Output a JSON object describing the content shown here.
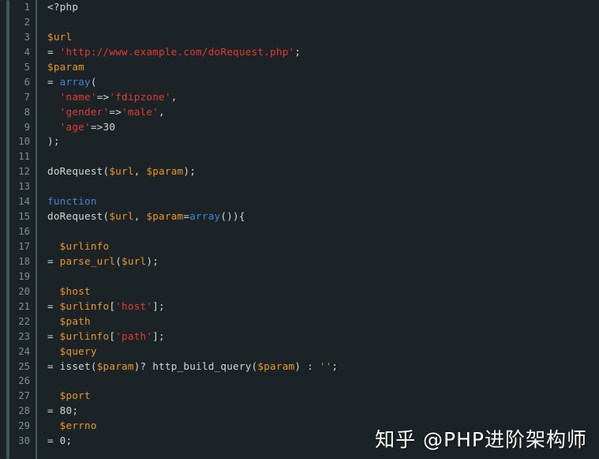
{
  "editor": {
    "language": "php",
    "background_color": "#1c2326",
    "line_number_color": "#7e8f93",
    "total_lines": 30,
    "first_visible_line": 1,
    "last_visible_line": 30
  },
  "palette": {
    "plain": "#d4d7d6",
    "variable": "#e8962e",
    "string": "#e03b35",
    "keyword": "#3d87d8",
    "function": "#e8962e",
    "number": "#d4d7d6",
    "gutter_rule": "#44565b",
    "scroll_rail": "#44565b"
  },
  "watermark": {
    "text": "知乎 @PHP进阶架构师",
    "color": "#ffffff"
  },
  "lines": [
    {
      "n": "1",
      "tokens": [
        {
          "t": "<?php",
          "c": "plain"
        }
      ]
    },
    {
      "n": "2",
      "tokens": []
    },
    {
      "n": "3",
      "tokens": [
        {
          "t": "$url",
          "c": "var"
        }
      ]
    },
    {
      "n": "4",
      "tokens": [
        {
          "t": "= ",
          "c": "plain"
        },
        {
          "t": "'http://www.example.com/doRequest.php'",
          "c": "string"
        },
        {
          "t": ";",
          "c": "punct"
        }
      ]
    },
    {
      "n": "5",
      "tokens": [
        {
          "t": "$param",
          "c": "var"
        }
      ]
    },
    {
      "n": "6",
      "tokens": [
        {
          "t": "= ",
          "c": "plain"
        },
        {
          "t": "array",
          "c": "keyword"
        },
        {
          "t": "(",
          "c": "punct"
        }
      ]
    },
    {
      "n": "7",
      "tokens": [
        {
          "t": "  ",
          "c": "plain"
        },
        {
          "t": "'name'",
          "c": "string"
        },
        {
          "t": "=>",
          "c": "plain"
        },
        {
          "t": "'fdipzone'",
          "c": "string"
        },
        {
          "t": ",",
          "c": "punct"
        }
      ]
    },
    {
      "n": "8",
      "tokens": [
        {
          "t": "  ",
          "c": "plain"
        },
        {
          "t": "'gender'",
          "c": "string"
        },
        {
          "t": "=>",
          "c": "plain"
        },
        {
          "t": "'male'",
          "c": "string"
        },
        {
          "t": ",",
          "c": "punct"
        }
      ]
    },
    {
      "n": "9",
      "tokens": [
        {
          "t": "  ",
          "c": "plain"
        },
        {
          "t": "'age'",
          "c": "string"
        },
        {
          "t": "=>",
          "c": "plain"
        },
        {
          "t": "30",
          "c": "num"
        }
      ]
    },
    {
      "n": "10",
      "tokens": [
        {
          "t": ");",
          "c": "punct"
        }
      ]
    },
    {
      "n": "11",
      "tokens": []
    },
    {
      "n": "12",
      "tokens": [
        {
          "t": "doRequest(",
          "c": "plain"
        },
        {
          "t": "$url",
          "c": "var"
        },
        {
          "t": ", ",
          "c": "plain"
        },
        {
          "t": "$param",
          "c": "var"
        },
        {
          "t": ");",
          "c": "punct"
        }
      ]
    },
    {
      "n": "13",
      "tokens": []
    },
    {
      "n": "14",
      "tokens": [
        {
          "t": "function",
          "c": "keyword"
        }
      ]
    },
    {
      "n": "15",
      "tokens": [
        {
          "t": "doRequest(",
          "c": "plain"
        },
        {
          "t": "$url",
          "c": "var"
        },
        {
          "t": ", ",
          "c": "plain"
        },
        {
          "t": "$param",
          "c": "var"
        },
        {
          "t": "=",
          "c": "plain"
        },
        {
          "t": "array",
          "c": "keyword"
        },
        {
          "t": "()){",
          "c": "punct"
        }
      ]
    },
    {
      "n": "16",
      "tokens": []
    },
    {
      "n": "17",
      "tokens": [
        {
          "t": "  ",
          "c": "plain"
        },
        {
          "t": "$urlinfo",
          "c": "var"
        }
      ]
    },
    {
      "n": "18",
      "tokens": [
        {
          "t": "= ",
          "c": "plain"
        },
        {
          "t": "parse_url",
          "c": "func"
        },
        {
          "t": "(",
          "c": "punct"
        },
        {
          "t": "$url",
          "c": "var"
        },
        {
          "t": ");",
          "c": "punct"
        }
      ]
    },
    {
      "n": "19",
      "tokens": []
    },
    {
      "n": "20",
      "tokens": [
        {
          "t": "  ",
          "c": "plain"
        },
        {
          "t": "$host",
          "c": "var"
        }
      ]
    },
    {
      "n": "21",
      "tokens": [
        {
          "t": "= ",
          "c": "plain"
        },
        {
          "t": "$urlinfo",
          "c": "var"
        },
        {
          "t": "[",
          "c": "punct"
        },
        {
          "t": "'host'",
          "c": "string"
        },
        {
          "t": "];",
          "c": "punct"
        }
      ]
    },
    {
      "n": "22",
      "tokens": [
        {
          "t": "  ",
          "c": "plain"
        },
        {
          "t": "$path",
          "c": "var"
        }
      ]
    },
    {
      "n": "23",
      "tokens": [
        {
          "t": "= ",
          "c": "plain"
        },
        {
          "t": "$urlinfo",
          "c": "var"
        },
        {
          "t": "[",
          "c": "punct"
        },
        {
          "t": "'path'",
          "c": "string"
        },
        {
          "t": "];",
          "c": "punct"
        }
      ]
    },
    {
      "n": "24",
      "tokens": [
        {
          "t": "  ",
          "c": "plain"
        },
        {
          "t": "$query",
          "c": "var"
        }
      ]
    },
    {
      "n": "25",
      "tokens": [
        {
          "t": "= isset(",
          "c": "plain"
        },
        {
          "t": "$param",
          "c": "var"
        },
        {
          "t": ")? http_build_query(",
          "c": "plain"
        },
        {
          "t": "$param",
          "c": "var"
        },
        {
          "t": ") : ",
          "c": "plain"
        },
        {
          "t": "''",
          "c": "emptystr"
        },
        {
          "t": ";",
          "c": "punct"
        }
      ]
    },
    {
      "n": "26",
      "tokens": []
    },
    {
      "n": "27",
      "tokens": [
        {
          "t": "  ",
          "c": "plain"
        },
        {
          "t": "$port",
          "c": "var"
        }
      ]
    },
    {
      "n": "28",
      "tokens": [
        {
          "t": "= ",
          "c": "plain"
        },
        {
          "t": "80",
          "c": "num"
        },
        {
          "t": ";",
          "c": "punct"
        }
      ]
    },
    {
      "n": "29",
      "tokens": [
        {
          "t": "  ",
          "c": "plain"
        },
        {
          "t": "$errno",
          "c": "var"
        }
      ]
    },
    {
      "n": "30",
      "tokens": [
        {
          "t": "= ",
          "c": "plain"
        },
        {
          "t": "0",
          "c": "num"
        },
        {
          "t": ";",
          "c": "punct"
        }
      ]
    }
  ]
}
